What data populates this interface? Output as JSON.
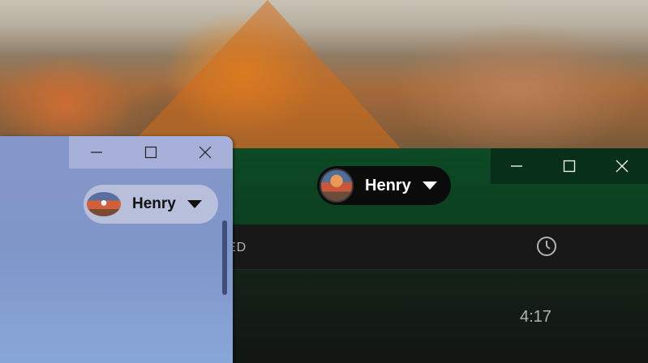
{
  "player": {
    "user": {
      "name": "Henry"
    },
    "table": {
      "column_title": "ED"
    },
    "track": {
      "duration": "4:17"
    },
    "colors": {
      "header": "#0d4a25",
      "background": "#121212"
    }
  },
  "side_window": {
    "user": {
      "name": "Henry"
    },
    "colors": {
      "background": "#8597c8"
    }
  },
  "icons": {
    "minimize": "minimize-icon",
    "maximize": "maximize-icon",
    "close": "close-icon",
    "dropdown": "caret-down-icon",
    "clock": "clock-icon"
  }
}
